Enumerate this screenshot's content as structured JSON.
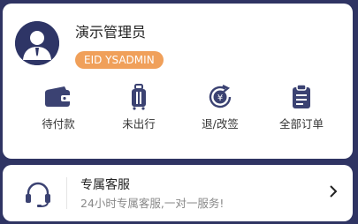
{
  "user": {
    "name": "演示管理员",
    "eid": "EID YSADMIN"
  },
  "actions": [
    {
      "label": "待付款",
      "icon": "wallet-icon"
    },
    {
      "label": "未出行",
      "icon": "luggage-icon"
    },
    {
      "label": "退/改签",
      "icon": "yen-refund-icon"
    },
    {
      "label": "全部订单",
      "icon": "clipboard-icon"
    }
  ],
  "service": {
    "title": "专属客服",
    "subtitle": "24小时专属客服,一对一服务!",
    "icon": "headset-icon"
  },
  "colors": {
    "background": "#2f3463",
    "icon": "#3b4272",
    "badge": "#f0a05a"
  }
}
